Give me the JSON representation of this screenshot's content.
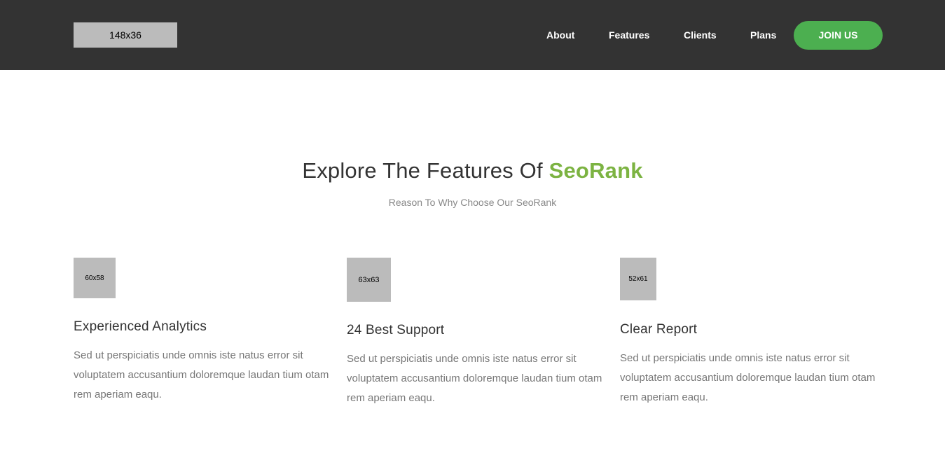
{
  "header": {
    "logo_label": "148x36",
    "nav": {
      "about": "About",
      "features": "Features",
      "clients": "Clients",
      "plans": "Plans"
    },
    "join_label": "JOIN US"
  },
  "section": {
    "title_prefix": "Explore The Features Of ",
    "title_accent": "SeoRank",
    "subtitle": "Reason To Why Choose Our SeoRank"
  },
  "features": [
    {
      "image_label": "60x58",
      "title": "Experienced Analytics",
      "text": "Sed ut perspiciatis unde omnis iste natus error sit voluptatem accusantium doloremque laudan tium otam rem aperiam eaqu."
    },
    {
      "image_label": "63x63",
      "title": "24 Best Support",
      "text": "Sed ut perspiciatis unde omnis iste natus error sit voluptatem accusantium doloremque laudan tium otam rem aperiam eaqu."
    },
    {
      "image_label": "52x61",
      "title": "Clear Report",
      "text": "Sed ut perspiciatis unde omnis iste natus error sit voluptatem accusantium doloremque laudan tium otam rem aperiam eaqu."
    }
  ],
  "colors": {
    "header_bg": "#333333",
    "accent_green": "#4caf50",
    "title_accent": "#7cb342",
    "placeholder": "#bbbbbb"
  }
}
